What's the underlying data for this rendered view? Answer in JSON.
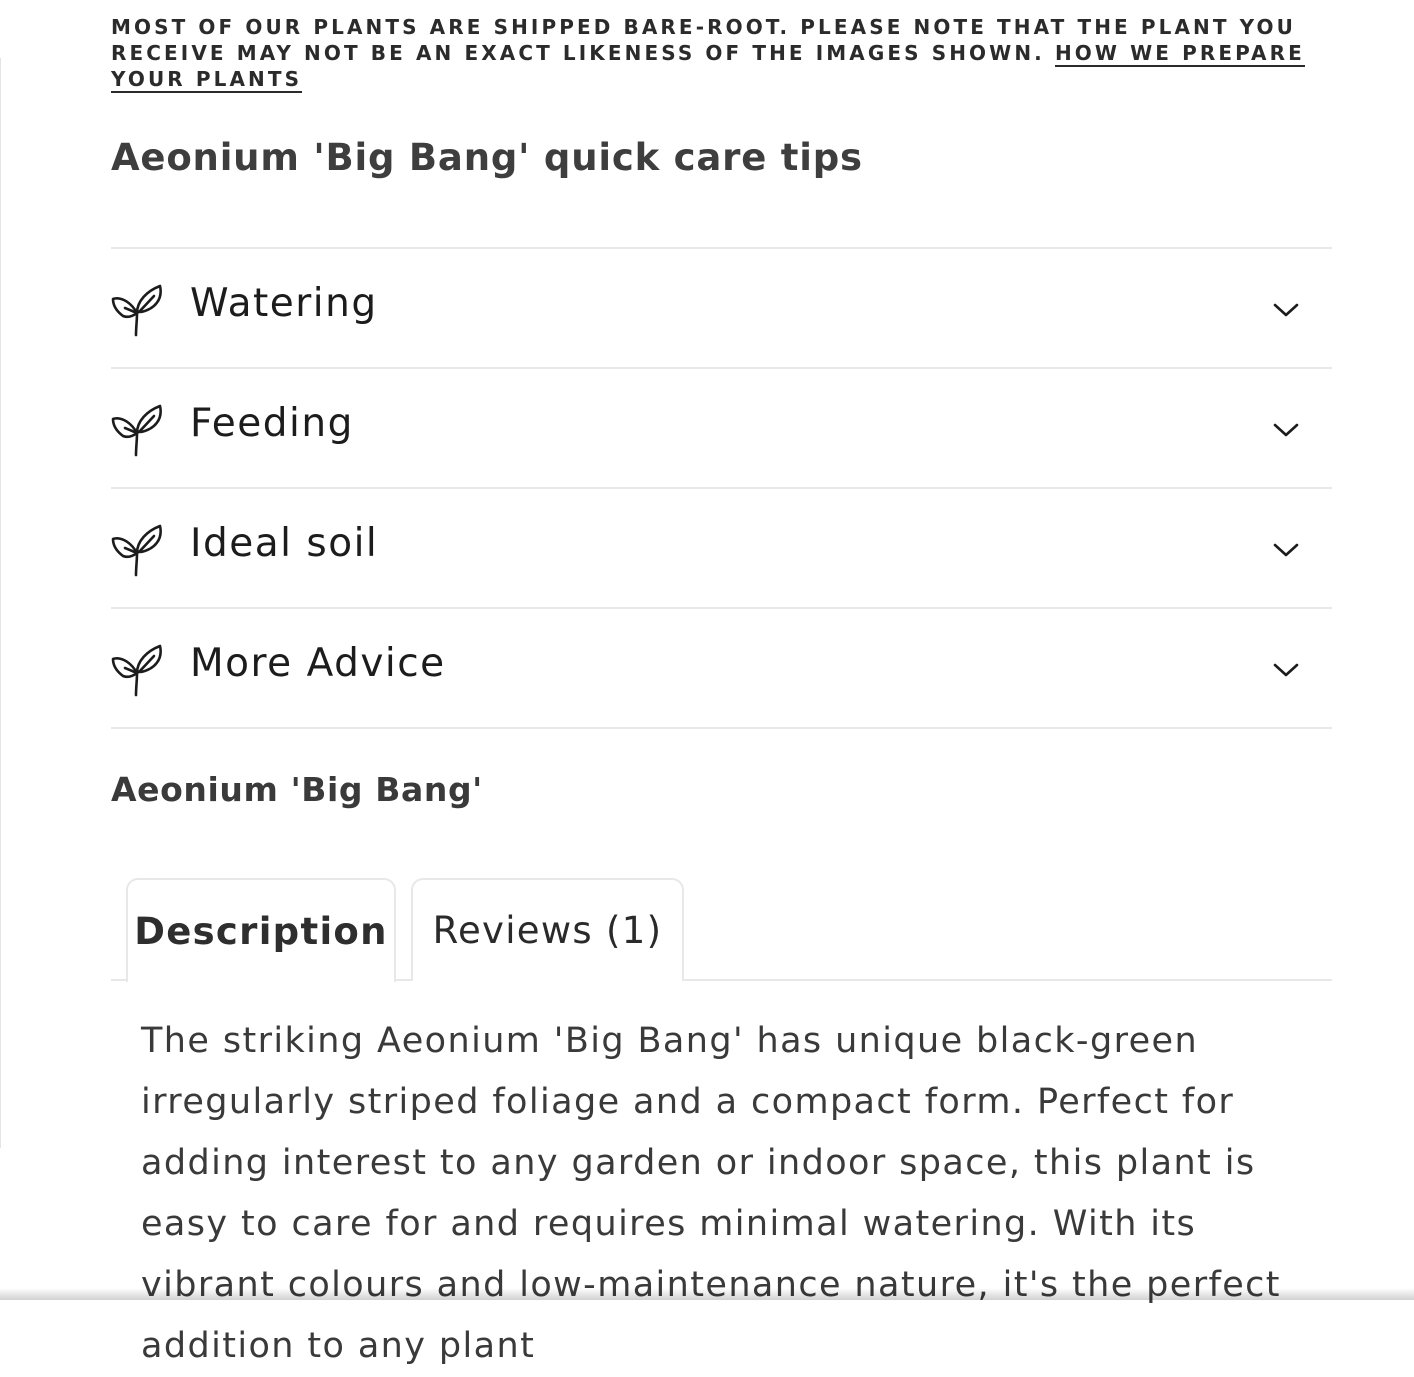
{
  "notice": {
    "text": "Most of our plants are shipped bare-root. Please note that the plant you receive may not be an exact likeness of the images shown.",
    "link": "How we prepare your plants"
  },
  "care": {
    "title": "Aeonium 'Big Bang' quick care tips",
    "items": [
      {
        "label": "Watering",
        "icon": "seedling-icon",
        "expanded": false
      },
      {
        "label": "Feeding",
        "icon": "seedling-icon",
        "expanded": false
      },
      {
        "label": "Ideal soil",
        "icon": "seedling-icon",
        "expanded": false
      },
      {
        "label": "More Advice",
        "icon": "seedling-icon",
        "expanded": false
      }
    ]
  },
  "product": {
    "name": "Aeonium 'Big Bang'"
  },
  "tabs": {
    "items": [
      {
        "label": "Description",
        "active": true
      },
      {
        "label": "Reviews (1)",
        "active": false
      }
    ]
  },
  "description": {
    "text": "The striking Aeonium 'Big Bang' has unique black-green irregularly striped foliage and a compact form. Perfect for adding interest to any garden or indoor space, this plant is easy to care for and requires minimal watering. With its vibrant colours and low-maintenance nature, it's the perfect addition to any plant"
  },
  "colors": {
    "text": "#1c1c1c",
    "heading": "#3e3e3e",
    "divider": "#e8e8e8",
    "background": "#ffffff"
  }
}
